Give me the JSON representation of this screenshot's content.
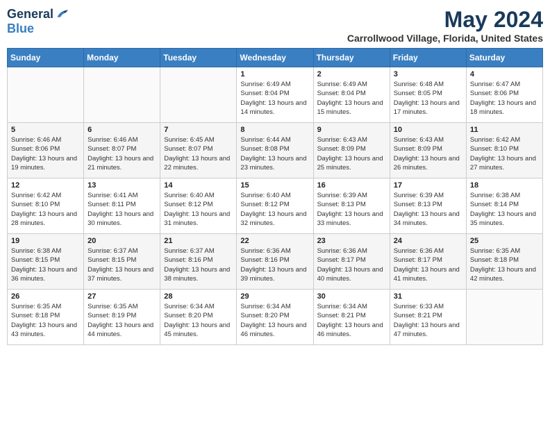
{
  "logo": {
    "general": "General",
    "blue": "Blue"
  },
  "title": {
    "month": "May 2024",
    "location": "Carrollwood Village, Florida, United States"
  },
  "weekdays": [
    "Sunday",
    "Monday",
    "Tuesday",
    "Wednesday",
    "Thursday",
    "Friday",
    "Saturday"
  ],
  "weeks": [
    [
      {
        "day": "",
        "info": ""
      },
      {
        "day": "",
        "info": ""
      },
      {
        "day": "",
        "info": ""
      },
      {
        "day": "1",
        "info": "Sunrise: 6:49 AM\nSunset: 8:04 PM\nDaylight: 13 hours and 14 minutes."
      },
      {
        "day": "2",
        "info": "Sunrise: 6:49 AM\nSunset: 8:04 PM\nDaylight: 13 hours and 15 minutes."
      },
      {
        "day": "3",
        "info": "Sunrise: 6:48 AM\nSunset: 8:05 PM\nDaylight: 13 hours and 17 minutes."
      },
      {
        "day": "4",
        "info": "Sunrise: 6:47 AM\nSunset: 8:06 PM\nDaylight: 13 hours and 18 minutes."
      }
    ],
    [
      {
        "day": "5",
        "info": "Sunrise: 6:46 AM\nSunset: 8:06 PM\nDaylight: 13 hours and 19 minutes."
      },
      {
        "day": "6",
        "info": "Sunrise: 6:46 AM\nSunset: 8:07 PM\nDaylight: 13 hours and 21 minutes."
      },
      {
        "day": "7",
        "info": "Sunrise: 6:45 AM\nSunset: 8:07 PM\nDaylight: 13 hours and 22 minutes."
      },
      {
        "day": "8",
        "info": "Sunrise: 6:44 AM\nSunset: 8:08 PM\nDaylight: 13 hours and 23 minutes."
      },
      {
        "day": "9",
        "info": "Sunrise: 6:43 AM\nSunset: 8:09 PM\nDaylight: 13 hours and 25 minutes."
      },
      {
        "day": "10",
        "info": "Sunrise: 6:43 AM\nSunset: 8:09 PM\nDaylight: 13 hours and 26 minutes."
      },
      {
        "day": "11",
        "info": "Sunrise: 6:42 AM\nSunset: 8:10 PM\nDaylight: 13 hours and 27 minutes."
      }
    ],
    [
      {
        "day": "12",
        "info": "Sunrise: 6:42 AM\nSunset: 8:10 PM\nDaylight: 13 hours and 28 minutes."
      },
      {
        "day": "13",
        "info": "Sunrise: 6:41 AM\nSunset: 8:11 PM\nDaylight: 13 hours and 30 minutes."
      },
      {
        "day": "14",
        "info": "Sunrise: 6:40 AM\nSunset: 8:12 PM\nDaylight: 13 hours and 31 minutes."
      },
      {
        "day": "15",
        "info": "Sunrise: 6:40 AM\nSunset: 8:12 PM\nDaylight: 13 hours and 32 minutes."
      },
      {
        "day": "16",
        "info": "Sunrise: 6:39 AM\nSunset: 8:13 PM\nDaylight: 13 hours and 33 minutes."
      },
      {
        "day": "17",
        "info": "Sunrise: 6:39 AM\nSunset: 8:13 PM\nDaylight: 13 hours and 34 minutes."
      },
      {
        "day": "18",
        "info": "Sunrise: 6:38 AM\nSunset: 8:14 PM\nDaylight: 13 hours and 35 minutes."
      }
    ],
    [
      {
        "day": "19",
        "info": "Sunrise: 6:38 AM\nSunset: 8:15 PM\nDaylight: 13 hours and 36 minutes."
      },
      {
        "day": "20",
        "info": "Sunrise: 6:37 AM\nSunset: 8:15 PM\nDaylight: 13 hours and 37 minutes."
      },
      {
        "day": "21",
        "info": "Sunrise: 6:37 AM\nSunset: 8:16 PM\nDaylight: 13 hours and 38 minutes."
      },
      {
        "day": "22",
        "info": "Sunrise: 6:36 AM\nSunset: 8:16 PM\nDaylight: 13 hours and 39 minutes."
      },
      {
        "day": "23",
        "info": "Sunrise: 6:36 AM\nSunset: 8:17 PM\nDaylight: 13 hours and 40 minutes."
      },
      {
        "day": "24",
        "info": "Sunrise: 6:36 AM\nSunset: 8:17 PM\nDaylight: 13 hours and 41 minutes."
      },
      {
        "day": "25",
        "info": "Sunrise: 6:35 AM\nSunset: 8:18 PM\nDaylight: 13 hours and 42 minutes."
      }
    ],
    [
      {
        "day": "26",
        "info": "Sunrise: 6:35 AM\nSunset: 8:18 PM\nDaylight: 13 hours and 43 minutes."
      },
      {
        "day": "27",
        "info": "Sunrise: 6:35 AM\nSunset: 8:19 PM\nDaylight: 13 hours and 44 minutes."
      },
      {
        "day": "28",
        "info": "Sunrise: 6:34 AM\nSunset: 8:20 PM\nDaylight: 13 hours and 45 minutes."
      },
      {
        "day": "29",
        "info": "Sunrise: 6:34 AM\nSunset: 8:20 PM\nDaylight: 13 hours and 46 minutes."
      },
      {
        "day": "30",
        "info": "Sunrise: 6:34 AM\nSunset: 8:21 PM\nDaylight: 13 hours and 46 minutes."
      },
      {
        "day": "31",
        "info": "Sunrise: 6:33 AM\nSunset: 8:21 PM\nDaylight: 13 hours and 47 minutes."
      },
      {
        "day": "",
        "info": ""
      }
    ]
  ]
}
